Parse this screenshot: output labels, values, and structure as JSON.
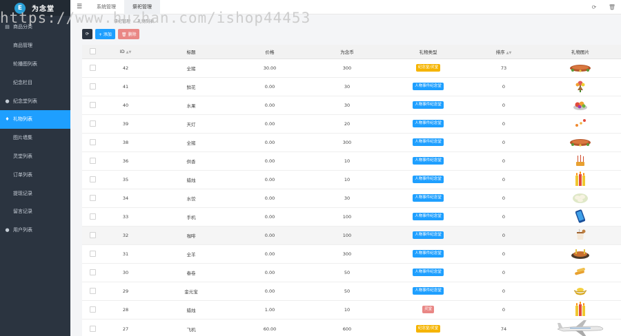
{
  "brand": {
    "title": "为念堂",
    "logo_char": "E"
  },
  "sidebar": {
    "items": [
      {
        "label": "商品分类",
        "icon": "calendar-icon",
        "glyph": "▤",
        "active": false
      },
      {
        "label": "商品管理",
        "icon": "none",
        "glyph": "",
        "active": false
      },
      {
        "label": "轮播图列表",
        "icon": "none",
        "glyph": "",
        "active": false
      },
      {
        "label": "纪念栏目",
        "icon": "none",
        "glyph": "",
        "active": false
      },
      {
        "label": "纪念堂列表",
        "icon": "user-icon",
        "glyph": "●",
        "active": false
      },
      {
        "label": "礼物列表",
        "icon": "bell-icon",
        "glyph": "♦",
        "active": true
      },
      {
        "label": "图片墙集",
        "icon": "none",
        "glyph": "",
        "active": false
      },
      {
        "label": "灵堂列表",
        "icon": "none",
        "glyph": "",
        "active": false
      },
      {
        "label": "订单列表",
        "icon": "none",
        "glyph": "",
        "active": false
      },
      {
        "label": "提现记录",
        "icon": "none",
        "glyph": "",
        "active": false
      },
      {
        "label": "留言记录",
        "icon": "none",
        "glyph": "",
        "active": false
      },
      {
        "label": "用户列表",
        "icon": "user-icon",
        "glyph": "●",
        "active": false
      }
    ]
  },
  "topbar": {
    "tabs": [
      {
        "label": "系统管理",
        "active": false
      },
      {
        "label": "祭祀管理",
        "active": true
      }
    ]
  },
  "watermark": "https://www.huzhan.com/ishop44453",
  "breadcrumb": [
    "祭祀管理",
    "礼物列表"
  ],
  "toolbar": {
    "add_label": "+ 添加",
    "delete_label": "🗑 删除"
  },
  "table": {
    "headers": {
      "id": "ID",
      "name": "标题",
      "price": "价格",
      "coins": "为念币",
      "type": "礼物类型",
      "sort": "排序",
      "image": "礼物图片"
    },
    "rows": [
      {
        "id": "42",
        "name": "全猪",
        "price": "30.00",
        "coins": "300",
        "type": "纪念堂/灵堂",
        "type_color": "#f5b400",
        "sort": "73",
        "image": "roast-pig-image"
      },
      {
        "id": "41",
        "name": "鲜花",
        "price": "0.00",
        "coins": "30",
        "type": "人物事件纪念堂",
        "type_color": "#1e9fff",
        "sort": "0",
        "image": "flower-image"
      },
      {
        "id": "40",
        "name": "水果",
        "price": "0.00",
        "coins": "30",
        "type": "人物事件纪念堂",
        "type_color": "#1e9fff",
        "sort": "0",
        "image": "fruit-image"
      },
      {
        "id": "39",
        "name": "天灯",
        "price": "0.00",
        "coins": "20",
        "type": "人物事件纪念堂",
        "type_color": "#1e9fff",
        "sort": "0",
        "image": "lantern-image"
      },
      {
        "id": "38",
        "name": "全猪",
        "price": "0.00",
        "coins": "300",
        "type": "人物事件纪念堂",
        "type_color": "#1e9fff",
        "sort": "0",
        "image": "roast-pig-image"
      },
      {
        "id": "36",
        "name": "供香",
        "price": "0.00",
        "coins": "10",
        "type": "人物事件纪念堂",
        "type_color": "#1e9fff",
        "sort": "0",
        "image": "incense-image"
      },
      {
        "id": "35",
        "name": "蜡烛",
        "price": "0.00",
        "coins": "10",
        "type": "人物事件纪念堂",
        "type_color": "#1e9fff",
        "sort": "0",
        "image": "candle-image"
      },
      {
        "id": "34",
        "name": "水饺",
        "price": "0.00",
        "coins": "30",
        "type": "人物事件纪念堂",
        "type_color": "#1e9fff",
        "sort": "0",
        "image": "dumpling-image"
      },
      {
        "id": "33",
        "name": "手机",
        "price": "0.00",
        "coins": "100",
        "type": "人物事件纪念堂",
        "type_color": "#1e9fff",
        "sort": "0",
        "image": "phone-image"
      },
      {
        "id": "32",
        "name": "咖啡",
        "price": "0.00",
        "coins": "100",
        "type": "人物事件纪念堂",
        "type_color": "#1e9fff",
        "sort": "0",
        "image": "coffee-image"
      },
      {
        "id": "31",
        "name": "全羊",
        "price": "0.00",
        "coins": "300",
        "type": "人物事件纪念堂",
        "type_color": "#1e9fff",
        "sort": "0",
        "image": "roast-lamb-image"
      },
      {
        "id": "30",
        "name": "春卷",
        "price": "0.00",
        "coins": "50",
        "type": "人物事件纪念堂",
        "type_color": "#1e9fff",
        "sort": "0",
        "image": "spring-roll-image"
      },
      {
        "id": "29",
        "name": "金元宝",
        "price": "0.00",
        "coins": "50",
        "type": "人物事件纪念堂",
        "type_color": "#1e9fff",
        "sort": "0",
        "image": "gold-ingot-image"
      },
      {
        "id": "28",
        "name": "蜡烛",
        "price": "1.00",
        "coins": "10",
        "type": "灵堂",
        "type_color": "#e98785",
        "sort": "0",
        "image": "candle-image"
      },
      {
        "id": "27",
        "name": "飞机",
        "price": "60.00",
        "coins": "600",
        "type": "纪念堂/灵堂",
        "type_color": "#f5b400",
        "sort": "74",
        "image": "airplane-image"
      }
    ]
  }
}
